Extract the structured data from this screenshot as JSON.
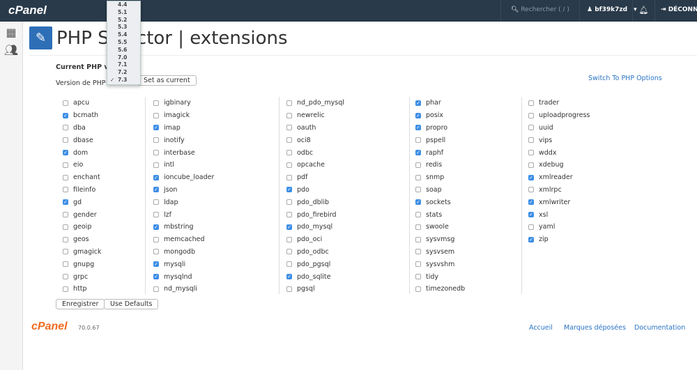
{
  "header": {
    "logo": "cPanel",
    "search_placeholder": "Rechercher ( / )",
    "user": "bf39k7zd",
    "logout": "DÉCONNEXION"
  },
  "page": {
    "title": "PHP Selector | extensions",
    "current_label": "Current PHP version",
    "version_label": "Version de PHP",
    "set_current": "Set as current",
    "switch": "Switch To PHP Options",
    "save": "Enregistrer",
    "defaults": "Use Defaults"
  },
  "dropdown": {
    "options": [
      "4.4",
      "5.1",
      "5.2",
      "5.3",
      "5.4",
      "5.5",
      "5.6",
      "7.0",
      "7.1",
      "7.2",
      "7.3"
    ],
    "selected": "7.3"
  },
  "columns": [
    [
      [
        "apcu",
        0
      ],
      [
        "bcmath",
        1
      ],
      [
        "dba",
        0
      ],
      [
        "dbase",
        0
      ],
      [
        "dom",
        1
      ],
      [
        "eio",
        0
      ],
      [
        "enchant",
        0
      ],
      [
        "fileinfo",
        0
      ],
      [
        "gd",
        1
      ],
      [
        "gender",
        0
      ],
      [
        "geoip",
        0
      ],
      [
        "geos",
        0
      ],
      [
        "gmagick",
        0
      ],
      [
        "gnupg",
        0
      ],
      [
        "grpc",
        0
      ],
      [
        "http",
        0
      ]
    ],
    [
      [
        "igbinary",
        0
      ],
      [
        "imagick",
        0
      ],
      [
        "imap",
        1
      ],
      [
        "inotify",
        0
      ],
      [
        "interbase",
        0
      ],
      [
        "intl",
        0
      ],
      [
        "ioncube_loader",
        1
      ],
      [
        "json",
        1
      ],
      [
        "ldap",
        0
      ],
      [
        "lzf",
        0
      ],
      [
        "mbstring",
        1
      ],
      [
        "memcached",
        0
      ],
      [
        "mongodb",
        0
      ],
      [
        "mysqli",
        1
      ],
      [
        "mysqlnd",
        1
      ],
      [
        "nd_mysqli",
        0
      ]
    ],
    [
      [
        "nd_pdo_mysql",
        0
      ],
      [
        "newrelic",
        0
      ],
      [
        "oauth",
        0
      ],
      [
        "oci8",
        0
      ],
      [
        "odbc",
        0
      ],
      [
        "opcache",
        0
      ],
      [
        "pdf",
        0
      ],
      [
        "pdo",
        1
      ],
      [
        "pdo_dblib",
        0
      ],
      [
        "pdo_firebird",
        0
      ],
      [
        "pdo_mysql",
        1
      ],
      [
        "pdo_oci",
        0
      ],
      [
        "pdo_odbc",
        0
      ],
      [
        "pdo_pgsql",
        0
      ],
      [
        "pdo_sqlite",
        1
      ],
      [
        "pgsql",
        0
      ]
    ],
    [
      [
        "phar",
        1
      ],
      [
        "posix",
        1
      ],
      [
        "propro",
        1
      ],
      [
        "pspell",
        0
      ],
      [
        "raphf",
        1
      ],
      [
        "redis",
        0
      ],
      [
        "snmp",
        0
      ],
      [
        "soap",
        0
      ],
      [
        "sockets",
        1
      ],
      [
        "stats",
        0
      ],
      [
        "swoole",
        0
      ],
      [
        "sysvmsg",
        0
      ],
      [
        "sysvsem",
        0
      ],
      [
        "sysvshm",
        0
      ],
      [
        "tidy",
        0
      ],
      [
        "timezonedb",
        0
      ]
    ],
    [
      [
        "trader",
        0
      ],
      [
        "uploadprogress",
        0
      ],
      [
        "uuid",
        0
      ],
      [
        "vips",
        0
      ],
      [
        "wddx",
        0
      ],
      [
        "xdebug",
        0
      ],
      [
        "xmlreader",
        1
      ],
      [
        "xmlrpc",
        0
      ],
      [
        "xmlwriter",
        1
      ],
      [
        "xsl",
        1
      ],
      [
        "yaml",
        0
      ],
      [
        "zip",
        1
      ]
    ]
  ],
  "footer": {
    "logo": "cPanel",
    "version": "70.0.67",
    "links": [
      "Accueil",
      "Marques déposées",
      "Documentation"
    ]
  },
  "colors": {
    "header": "#293a4a",
    "accent": "#3d8ee6",
    "brand": "#f26b22"
  }
}
